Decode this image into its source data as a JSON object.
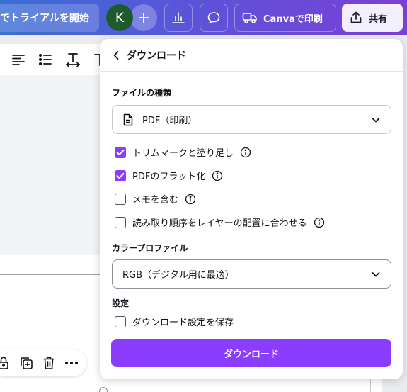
{
  "topbar": {
    "trial_label": "でトライアルを開始",
    "avatar_letter": "K",
    "plus_label": "+",
    "print_label": "Canvaで印刷",
    "share_label": "共有"
  },
  "panel": {
    "title": "ダウンロード",
    "file_type_label": "ファイルの種類",
    "file_type_value": "PDF（印刷）",
    "options": [
      {
        "label": "トリムマークと塗り足し",
        "checked": true
      },
      {
        "label": "PDFのフラット化",
        "checked": true
      },
      {
        "label": "メモを含む",
        "checked": false
      },
      {
        "label": "読み取り順序をレイヤーの配置に合わせる",
        "checked": false
      }
    ],
    "color_profile_label": "カラープロファイル",
    "color_profile_value": "RGB（デジタル用に最適）",
    "settings_label": "設定",
    "save_settings_label": "ダウンロード設定を保存",
    "save_settings_checked": false,
    "download_button_label": "ダウンロード"
  },
  "colors": {
    "accent": "#8b3dff",
    "topbar_start": "#3a6fd4",
    "topbar_end": "#7b3fd6"
  },
  "icons": {
    "toolbar": [
      "align-left-icon",
      "list-icon",
      "letter-spacing-icon",
      "text-icon"
    ],
    "bottom_toolbar": [
      "lock-icon",
      "duplicate-icon",
      "trash-icon",
      "more-icon"
    ]
  }
}
